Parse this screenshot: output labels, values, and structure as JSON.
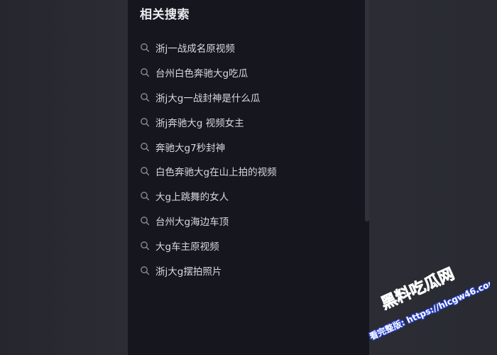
{
  "panel": {
    "title": "相关搜索"
  },
  "icons": {
    "result": "search-icon"
  },
  "results": [
    {
      "text": "浙j一战成名原视频"
    },
    {
      "text": "台州白色奔驰大g吃瓜"
    },
    {
      "text": "浙j大g一战封神是什么瓜"
    },
    {
      "text": "浙j奔驰大g 视频女主"
    },
    {
      "text": "奔驰大g7秒封神"
    },
    {
      "text": "白色奔驰大g在山上拍的视频"
    },
    {
      "text": "大g上跳舞的女人"
    },
    {
      "text": "台州大g海边车顶"
    },
    {
      "text": "大g车主原视频"
    },
    {
      "text": "浙j大g摆拍照片"
    }
  ],
  "watermark": {
    "brand": "黑料吃瓜网",
    "line": "看完整版: https://hlcgw46.com"
  },
  "colors": {
    "panel_bg": "#16171e",
    "page_bg": "#2b2c34",
    "text": "#d9d9df",
    "watermark_blue": "#3d5cff"
  }
}
